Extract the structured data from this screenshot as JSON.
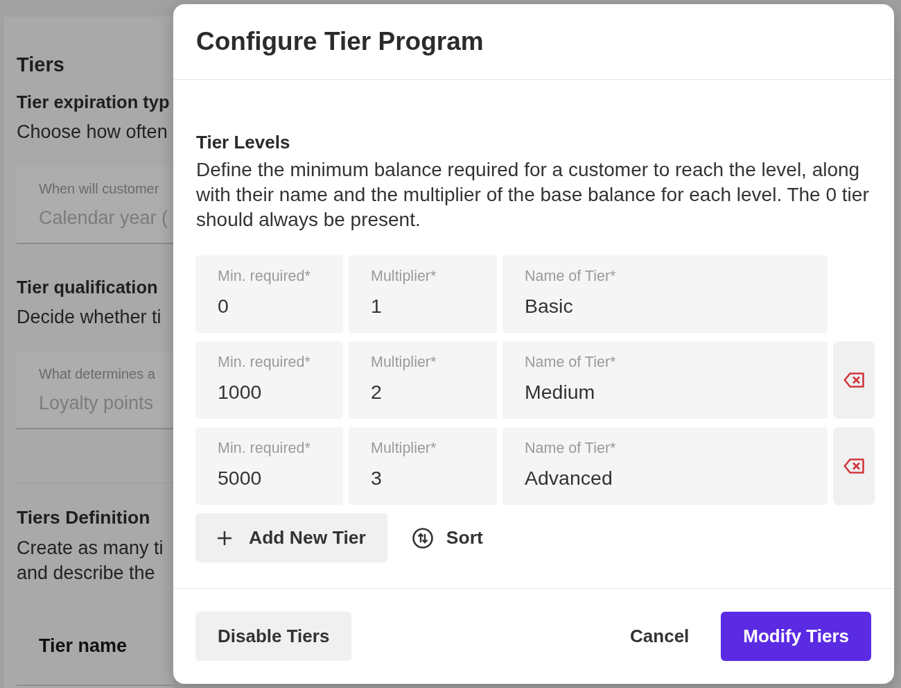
{
  "background_page": {
    "title": "Tiers",
    "sections": [
      {
        "title": "Tier expiration typ",
        "description": "Choose how often",
        "field": {
          "label": "When will customer",
          "value": "Calendar year (",
          "disabled": true
        }
      },
      {
        "title": "Tier qualification",
        "description": "Decide whether ti",
        "field": {
          "label": "What determines a",
          "value": "Loyalty points",
          "disabled": true
        }
      }
    ],
    "definition": {
      "title": "Tiers Definition",
      "description_lines": [
        "Create as many ti",
        "and describe the"
      ]
    },
    "table": {
      "columns": [
        "Tier name"
      ]
    }
  },
  "dialog": {
    "title": "Configure Tier Program",
    "section": {
      "title": "Tier Levels",
      "description_lines": [
        "Define the minimum balance required for a customer to reach the level, along",
        "with their name and the multiplier of the base balance for each level. The 0 tier",
        "should always be present."
      ]
    },
    "tiers": [
      {
        "fields": [
          {
            "label": "Min. required*",
            "value": "0"
          },
          {
            "label": "Multiplier*",
            "value": "1"
          },
          {
            "label": "Name of Tier*",
            "value": "Basic"
          }
        ],
        "removable": false
      },
      {
        "fields": [
          {
            "label": "Min. required*",
            "value": "1000"
          },
          {
            "label": "Multiplier*",
            "value": "2"
          },
          {
            "label": "Name of Tier*",
            "value": "Medium"
          }
        ],
        "removable": true
      },
      {
        "fields": [
          {
            "label": "Min. required*",
            "value": "5000"
          },
          {
            "label": "Multiplier*",
            "value": "3"
          },
          {
            "label": "Name of Tier*",
            "value": "Advanced"
          }
        ],
        "removable": true
      }
    ],
    "actions": [
      {
        "label": "Add New Tier",
        "kind": "add"
      },
      {
        "label": "Sort",
        "kind": "sort"
      }
    ],
    "footer_buttons": [
      {
        "label": "Disable Tiers",
        "kind": "secondary"
      },
      {
        "label": "Cancel",
        "kind": "text"
      },
      {
        "label": "Modify Tiers",
        "kind": "primary"
      }
    ]
  }
}
